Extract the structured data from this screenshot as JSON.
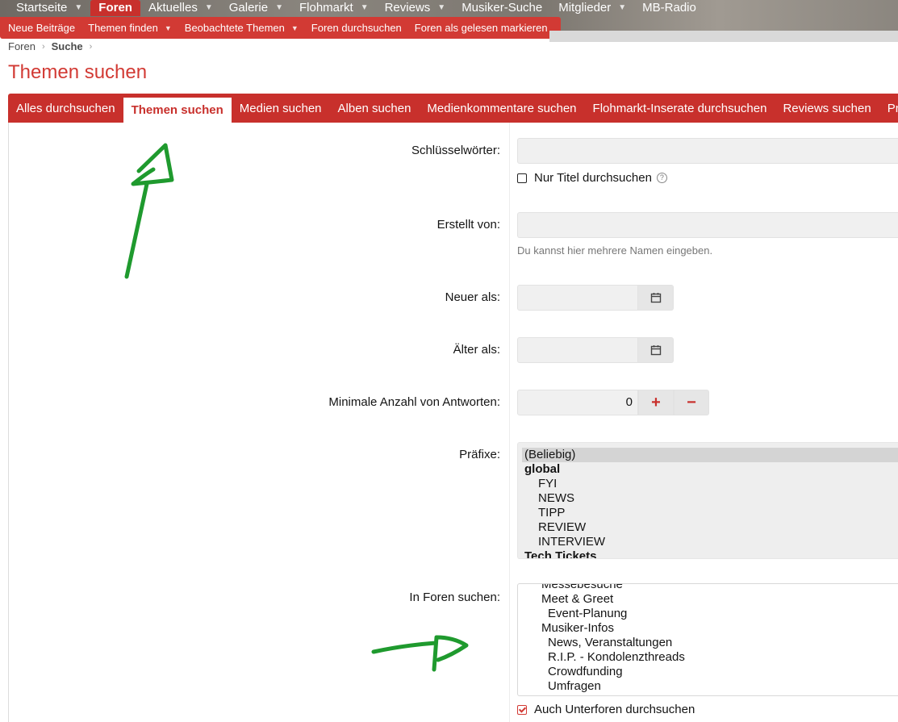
{
  "nav": {
    "tabs": [
      {
        "label": "Startseite",
        "caret": true
      },
      {
        "label": "Foren",
        "caret": false,
        "active": true
      },
      {
        "label": "Aktuelles",
        "caret": true
      },
      {
        "label": "Galerie",
        "caret": true
      },
      {
        "label": "Flohmarkt",
        "caret": true
      },
      {
        "label": "Reviews",
        "caret": true
      },
      {
        "label": "Musiker-Suche",
        "caret": false
      },
      {
        "label": "Mitglieder",
        "caret": true
      },
      {
        "label": "MB-Radio",
        "caret": false
      }
    ],
    "caret_glyph": "▼"
  },
  "subnav": {
    "items": [
      {
        "label": "Neue Beiträge"
      },
      {
        "label": "Themen finden"
      },
      {
        "label": "Beobachtete Themen"
      },
      {
        "label": "Foren durchsuchen"
      },
      {
        "label": "Foren als gelesen markieren"
      }
    ]
  },
  "breadcrumb": {
    "items": [
      "Foren",
      "Suche"
    ],
    "sep": "›"
  },
  "page": {
    "title": "Themen suchen"
  },
  "tabs": [
    "Alles durchsuchen",
    "Themen suchen",
    "Medien suchen",
    "Alben suchen",
    "Medienkommentare suchen",
    "Flohmarkt-Inserate durchsuchen",
    "Reviews suchen",
    "Pr"
  ],
  "form": {
    "keywords_label": "Schlüsselwörter:",
    "keywords_value": "",
    "titles_only_label": "Nur Titel durchsuchen",
    "help_glyph": "?",
    "created_by_label": "Erstellt von:",
    "created_by_value": "",
    "created_by_hint": "Du kannst hier mehrere Namen eingeben.",
    "newer_label": "Neuer als:",
    "older_label": "Älter als:",
    "min_replies_label": "Minimale Anzahl von Antworten:",
    "min_replies_value": "0",
    "plus_glyph": "+",
    "minus_glyph": "−",
    "prefixes_label": "Präfixe:",
    "prefix_options": [
      {
        "label": "(Beliebig)",
        "type": "selected"
      },
      {
        "label": "global",
        "type": "group"
      },
      {
        "label": "FYI",
        "type": "option"
      },
      {
        "label": "NEWS",
        "type": "option"
      },
      {
        "label": "TIPP",
        "type": "option"
      },
      {
        "label": "REVIEW",
        "type": "option"
      },
      {
        "label": "INTERVIEW",
        "type": "option"
      },
      {
        "label": "Tech Tickets",
        "type": "group"
      }
    ],
    "forums_label": "In Foren suchen:",
    "forum_options": [
      {
        "label": "Messebesuche",
        "level": 2
      },
      {
        "label": "Meet & Greet",
        "level": 2
      },
      {
        "label": "Event-Planung",
        "level": 3
      },
      {
        "label": "Musiker-Infos",
        "level": 2
      },
      {
        "label": "News, Veranstaltungen",
        "level": 3
      },
      {
        "label": "R.I.P. - Kondolenzthreads",
        "level": 3
      },
      {
        "label": "Crowdfunding",
        "level": 3
      },
      {
        "label": "Umfragen",
        "level": 3
      }
    ],
    "subforums_label": "Auch Unterforen durchsuchen"
  },
  "colors": {
    "brand_red": "#c8302c",
    "title_red": "#d23a34",
    "annotation_green": "#1f9a2e"
  },
  "icons": {
    "calendar": "calendar-icon"
  }
}
